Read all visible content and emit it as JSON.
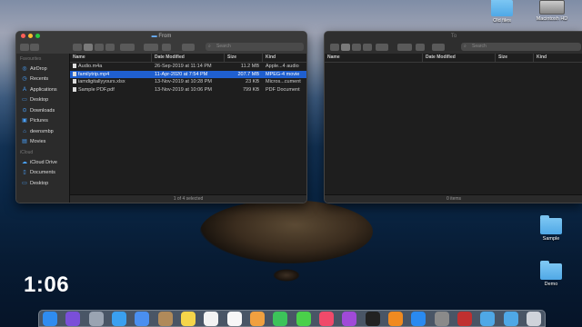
{
  "desktop": {
    "icons": [
      {
        "label": "Old files"
      },
      {
        "label": "Macintosh HD"
      },
      {
        "label": "Sample"
      },
      {
        "label": "Demo"
      }
    ]
  },
  "front_window": {
    "title": "From",
    "search_placeholder": "Search",
    "sidebar": {
      "favourites_heading": "Favourites",
      "favourites": [
        {
          "label": "AirDrop",
          "icon": "airdrop-icon"
        },
        {
          "label": "Recents",
          "icon": "recents-icon"
        },
        {
          "label": "Applications",
          "icon": "applications-icon"
        },
        {
          "label": "Desktop",
          "icon": "desktop-icon"
        },
        {
          "label": "Downloads",
          "icon": "downloads-icon"
        },
        {
          "label": "Pictures",
          "icon": "pictures-icon"
        },
        {
          "label": "deensmbp",
          "icon": "home-icon"
        },
        {
          "label": "Movies",
          "icon": "movies-icon"
        }
      ],
      "icloud_heading": "iCloud",
      "icloud": [
        {
          "label": "iCloud Drive",
          "icon": "cloud-icon"
        },
        {
          "label": "Documents",
          "icon": "documents-icon"
        },
        {
          "label": "Desktop",
          "icon": "desktop-icon"
        }
      ]
    },
    "columns": {
      "name": "Name",
      "date": "Date Modified",
      "size": "Size",
      "kind": "Kind"
    },
    "files": [
      {
        "name": "Audio.m4a",
        "date": "26-Sep-2019 at 11:14 PM",
        "size": "11.2 MB",
        "kind": "Apple...4 audio",
        "selected": false
      },
      {
        "name": "familytrip.mp4",
        "date": "11-Apr-2020 at 7:54 PM",
        "size": "207.7 MB",
        "kind": "MPEG-4 movie",
        "selected": true
      },
      {
        "name": "iamdigitallyyours.xlsx",
        "date": "13-Nov-2019 at 10:28 PM",
        "size": "23 KB",
        "kind": "Micros...cument",
        "selected": false
      },
      {
        "name": "Sample PDF.pdf",
        "date": "13-Nov-2019 at 10:06 PM",
        "size": "799 KB",
        "kind": "PDF Document",
        "selected": false
      }
    ],
    "status": "1 of 4 selected"
  },
  "back_window": {
    "title": "To",
    "search_placeholder": "Search",
    "columns": {
      "name": "Name",
      "date": "Date Modified",
      "size": "Size",
      "kind": "Kind"
    },
    "status": "0 items"
  },
  "timer": "1:06",
  "dock": {
    "apps": [
      {
        "icon": "finder-icon",
        "color": "#2f8cf0"
      },
      {
        "icon": "siri-icon",
        "color": "#7a4fd8"
      },
      {
        "icon": "launchpad-icon",
        "color": "#9aa4b2"
      },
      {
        "icon": "safari-icon",
        "color": "#3aa0f0"
      },
      {
        "icon": "mail-icon",
        "color": "#4a8ff0"
      },
      {
        "icon": "contacts-icon",
        "color": "#b08a5a"
      },
      {
        "icon": "notes-icon",
        "color": "#f5d54a"
      },
      {
        "icon": "calendar-icon",
        "color": "#f2f2f2"
      },
      {
        "icon": "reminders-icon",
        "color": "#f7f7f7"
      },
      {
        "icon": "photos-icon",
        "color": "#f0a040"
      },
      {
        "icon": "facetime-icon",
        "color": "#3cc35a"
      },
      {
        "icon": "messages-icon",
        "color": "#4ad04a"
      },
      {
        "icon": "music-icon",
        "color": "#f04a6a"
      },
      {
        "icon": "podcasts-icon",
        "color": "#a04ad8"
      },
      {
        "icon": "tv-icon",
        "color": "#222222"
      },
      {
        "icon": "books-icon",
        "color": "#f08a20"
      },
      {
        "icon": "app-store-icon",
        "color": "#2a8af0"
      },
      {
        "icon": "system-preferences-icon",
        "color": "#8a8a8a"
      },
      {
        "icon": "photo-booth-icon",
        "color": "#c03030"
      },
      {
        "icon": "folder-icon",
        "color": "#4fa8e6"
      },
      {
        "icon": "downloads-stack-icon",
        "color": "#4fa8e6"
      },
      {
        "icon": "trash-icon",
        "color": "#cfd3da"
      }
    ]
  }
}
